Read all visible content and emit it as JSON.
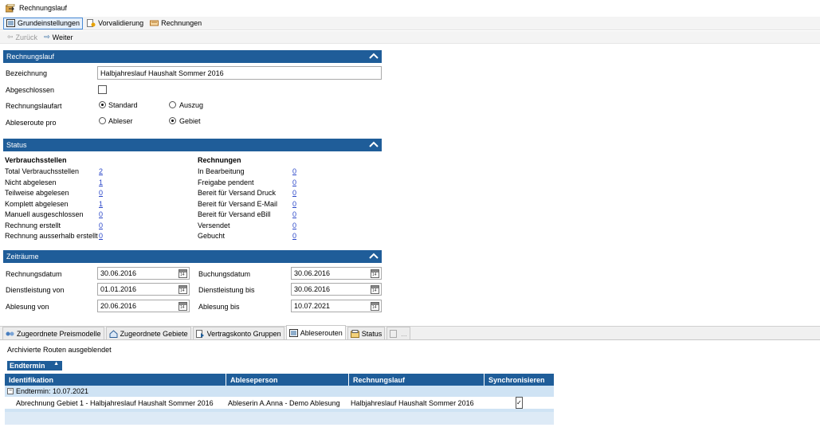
{
  "window": {
    "title": "Rechnungslauf"
  },
  "top_tabs": [
    {
      "label": "Grundeinstellungen",
      "active": true
    },
    {
      "label": "Vorvalidierung",
      "active": false
    },
    {
      "label": "Rechnungen",
      "active": false
    }
  ],
  "nav": {
    "back_label": "Zurück",
    "next_label": "Weiter"
  },
  "rechnungslauf": {
    "header": "Rechnungslauf",
    "bezeichnung_label": "Bezeichnung",
    "bezeichnung_value": "Halbjahreslauf Haushalt Sommer 2016",
    "abgeschlossen_label": "Abgeschlossen",
    "abgeschlossen_checked": false,
    "art_label": "Rechnungslaufart",
    "art_options": [
      "Standard",
      "Auszug"
    ],
    "art_selected": "Standard",
    "route_label": "Ableseroute pro",
    "route_options": [
      "Ableser",
      "Gebiet"
    ],
    "route_selected": "Gebiet"
  },
  "status": {
    "header": "Status",
    "verbrauch_title": "Verbrauchsstellen",
    "verbrauch": [
      {
        "label": "Total Verbrauchsstellen",
        "value": "2"
      },
      {
        "label": "Nicht abgelesen",
        "value": "1"
      },
      {
        "label": "Teilweise abgelesen",
        "value": "0"
      },
      {
        "label": "Komplett abgelesen",
        "value": "1"
      },
      {
        "label": "Manuell ausgeschlossen",
        "value": "0"
      },
      {
        "label": "Rechnung erstellt",
        "value": "0"
      },
      {
        "label": "Rechnung ausserhalb erstellt",
        "value": "0"
      }
    ],
    "rechnungen_title": "Rechnungen",
    "rechnungen": [
      {
        "label": "In Bearbeitung",
        "value": "0"
      },
      {
        "label": "Freigabe pendent",
        "value": "0"
      },
      {
        "label": "Bereit für Versand Druck",
        "value": "0"
      },
      {
        "label": "Bereit für Versand E-Mail",
        "value": "0"
      },
      {
        "label": "Bereit für Versand eBill",
        "value": "0"
      },
      {
        "label": "Versendet",
        "value": "0"
      },
      {
        "label": "Gebucht",
        "value": "0"
      }
    ]
  },
  "zeitraeume": {
    "header": "Zeiträume",
    "rechnungsdatum_label": "Rechnungsdatum",
    "rechnungsdatum": "30.06.2016",
    "buchungsdatum_label": "Buchungsdatum",
    "buchungsdatum": "30.06.2016",
    "dl_von_label": "Dienstleistung von",
    "dl_von": "01.01.2016",
    "dl_bis_label": "Dienstleistung bis",
    "dl_bis": "30.06.2016",
    "ablesung_von_label": "Ablesung von",
    "ablesung_von": "20.06.2016",
    "ablesung_bis_label": "Ablesung bis",
    "ablesung_bis": "10.07.2021",
    "cal_glyph": "14"
  },
  "bottom_tabs": [
    {
      "label": "Zugeordnete Preismodelle",
      "active": false
    },
    {
      "label": "Zugeordnete Gebiete",
      "active": false
    },
    {
      "label": "Vertragskonto Gruppen",
      "active": false
    },
    {
      "label": "Ableserouten",
      "active": true
    },
    {
      "label": "Status",
      "active": false
    },
    {
      "label": "...",
      "active": false
    }
  ],
  "routes": {
    "info": "Archivierte Routen ausgeblendet",
    "group_by": "Endtermin",
    "columns": [
      "Identifikation",
      "Ableseperson",
      "Rechnungslauf",
      "Synchronisieren"
    ],
    "group_label": "Endtermin:  10.07.2021",
    "rows": [
      {
        "identifikation": "Abrechnung Gebiet 1 - Halbjahreslauf Haushalt Sommer 2016",
        "ableseperson": "Ableserin A.Anna - Demo Ablesung",
        "rechnungslauf": "Halbjahreslauf Haushalt Sommer 2016",
        "synchronisieren": true
      }
    ]
  },
  "colors": {
    "header_blue": "#1f5d99",
    "group_row": "#cfe3f4",
    "link": "#2a46c8"
  }
}
